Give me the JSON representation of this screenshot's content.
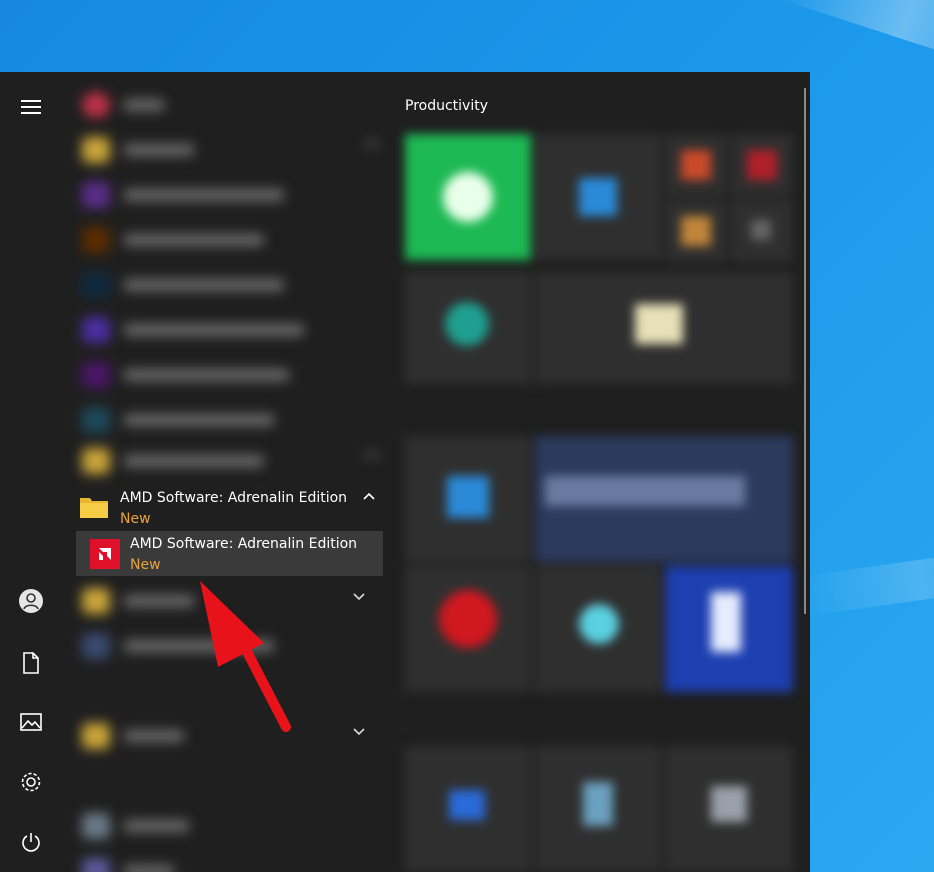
{
  "start_menu": {
    "tiles": {
      "section_title": "Productivity"
    },
    "app_list": {
      "folder": {
        "title": "AMD Software: Adrenalin Edition",
        "badge": "New"
      },
      "app": {
        "title": "AMD Software: Adrenalin Edition",
        "badge": "New"
      }
    },
    "rail": {
      "icons": [
        "hamburger-menu-icon",
        "user-icon",
        "document-icon",
        "pictures-icon",
        "settings-icon",
        "power-icon"
      ]
    }
  },
  "colors": {
    "desktop_blue": "#1b98ea",
    "menu_bg": "#1f1f1f",
    "new_badge": "#e8a33b",
    "amd_red": "#e0102b",
    "arrow_red": "#e8121b"
  }
}
